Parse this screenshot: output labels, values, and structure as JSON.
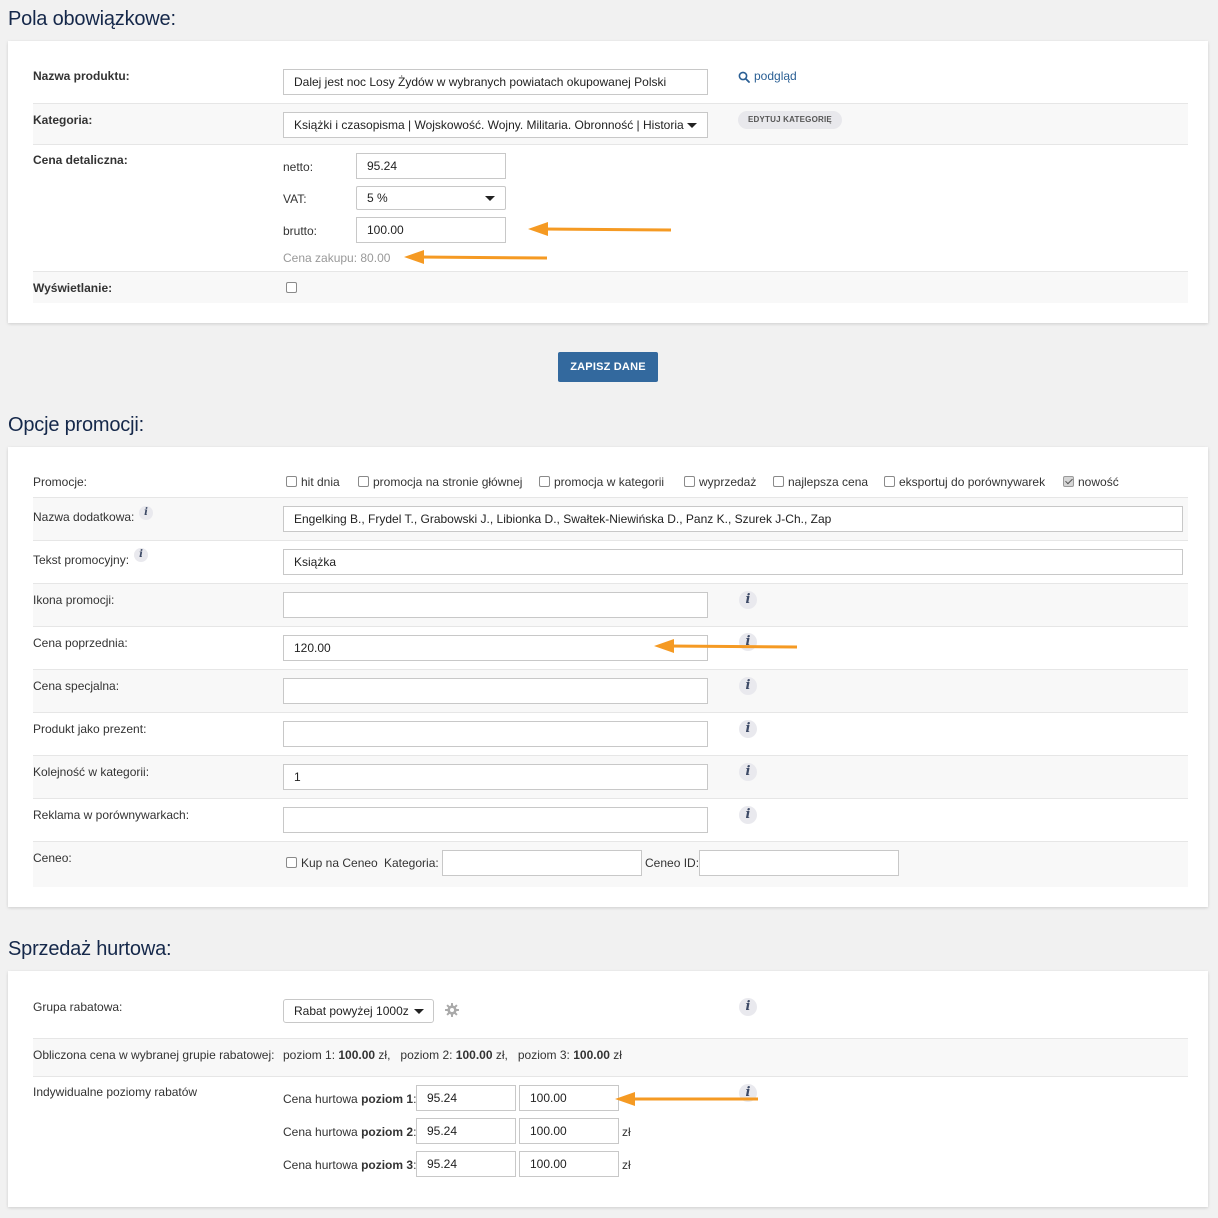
{
  "required": {
    "title": "Pola obowiązkowe:",
    "product_name_label": "Nazwa produktu:",
    "product_name_value": "Dalej jest noc Losy Żydów w wybranych powiatach okupowanej Polski",
    "preview_link": "podgląd",
    "category_label": "Kategoria:",
    "category_value": "Książki i czasopisma | Wojskowość. Wojny. Militaria. Obronność | Historia",
    "edit_category_button": "EDYTUJ KATEGORIĘ",
    "retail_price_label": "Cena detaliczna:",
    "netto_label": "netto:",
    "netto_value": "95.24",
    "vat_label": "VAT:",
    "vat_value": "5 %",
    "brutto_label": "brutto:",
    "brutto_value": "100.00",
    "purchase_price": "Cena zakupu: 80.00",
    "display_label": "Wyświetlanie:"
  },
  "save_button": "ZAPISZ DANE",
  "promo": {
    "title": "Opcje promocji:",
    "promotions_label": "Promocje:",
    "options": [
      {
        "label": "hit dnia",
        "checked": false
      },
      {
        "label": "promocja na stronie głównej",
        "checked": false
      },
      {
        "label": "promocja w kategorii",
        "checked": false
      },
      {
        "label": "wyprzedaż",
        "checked": false
      },
      {
        "label": "najlepsza cena",
        "checked": false
      },
      {
        "label": "eksportuj do porównywarek",
        "checked": false
      },
      {
        "label": "nowość",
        "checked": true
      }
    ],
    "extra_name_label": "Nazwa dodatkowa:",
    "extra_name_value": "Engelking B., Frydel T., Grabowski J., Libionka D., Swałtek-Niewińska D., Panz K., Szurek J-Ch., Zap",
    "promo_text_label": "Tekst promocyjny:",
    "promo_text_value": "Książka",
    "promo_icon_label": "Ikona promocji:",
    "promo_icon_value": "",
    "prev_price_label": "Cena poprzednia:",
    "prev_price_value": "120.00",
    "special_price_label": "Cena specjalna:",
    "special_price_value": "",
    "gift_label": "Produkt jako prezent:",
    "gift_value": "",
    "order_label": "Kolejność w kategorii:",
    "order_value": "1",
    "ads_label": "Reklama w porównywarkach:",
    "ads_value": "",
    "ceneo_label": "Ceneo:",
    "ceneo_buy": "Kup na Ceneo",
    "ceneo_category_label": "Kategoria:",
    "ceneo_category_value": "",
    "ceneo_id_label": "Ceneo ID:",
    "ceneo_id_value": ""
  },
  "wholesale": {
    "title": "Sprzedaż hurtowa:",
    "group_label": "Grupa rabatowa:",
    "group_value": "Rabat powyżej 1000z",
    "computed_label": "Obliczona cena w wybranej grupie rabatowej:",
    "levels_computed": [
      {
        "prefix": "poziom 1:",
        "value": "100.00",
        "unit": "zł,"
      },
      {
        "prefix": "poziom 2:",
        "value": "100.00",
        "unit": "zł,"
      },
      {
        "prefix": "poziom 3:",
        "value": "100.00",
        "unit": "zł"
      }
    ],
    "individual_label": "Indywidualne poziomy rabatów",
    "level_rows": [
      {
        "prefix": "Cena hurtowa",
        "bold": "poziom 1",
        "suffix": ":",
        "netto": "95.24",
        "brutto": "100.00",
        "unit": ""
      },
      {
        "prefix": "Cena hurtowa",
        "bold": "poziom 2",
        "suffix": ":",
        "netto": "95.24",
        "brutto": "100.00",
        "unit": "zł"
      },
      {
        "prefix": "Cena hurtowa",
        "bold": "poziom 3",
        "suffix": ":",
        "netto": "95.24",
        "brutto": "100.00",
        "unit": "zł"
      }
    ]
  },
  "colors": {
    "title": "#15284a",
    "primary_button": "#33699e",
    "annotation_arrow": "#f59a23",
    "link": "#2a5f94"
  }
}
